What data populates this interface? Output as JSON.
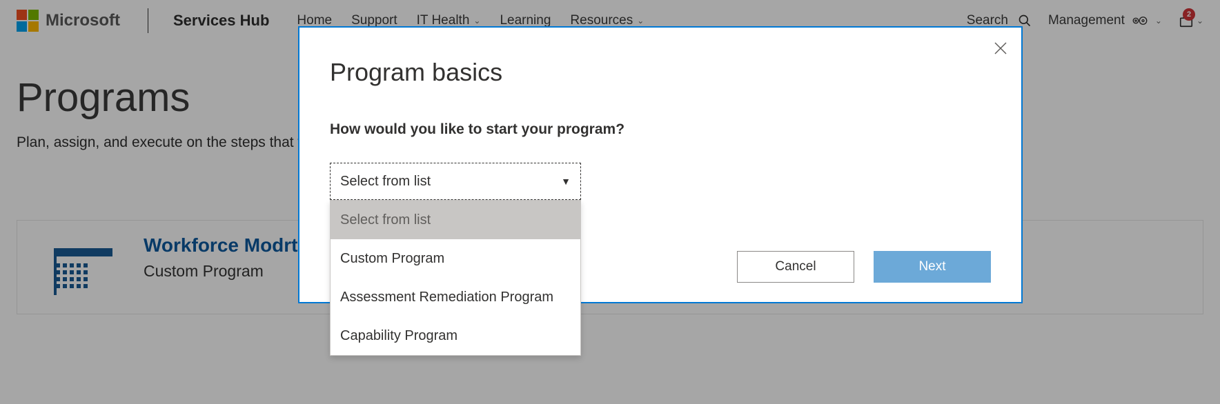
{
  "header": {
    "brand_logo_text": "Microsoft",
    "product_name": "Services Hub",
    "nav": [
      "Home",
      "Support",
      "IT Health",
      "Learning",
      "Resources"
    ],
    "search_label": "Search",
    "management_label": "Management",
    "notification_count": "2"
  },
  "page": {
    "title": "Programs",
    "subtitle": "Plan, assign, and execute on the steps that w"
  },
  "card": {
    "title": "Workforce Modrt Teams",
    "subtitle": "Custom Program"
  },
  "modal": {
    "title": "Program basics",
    "question": "How would you like to start your program?",
    "select_placeholder": "Select from list",
    "options": [
      "Select from list",
      "Custom Program",
      "Assessment Remediation Program",
      "Capability Program"
    ],
    "cancel_label": "Cancel",
    "next_label": "Next"
  }
}
